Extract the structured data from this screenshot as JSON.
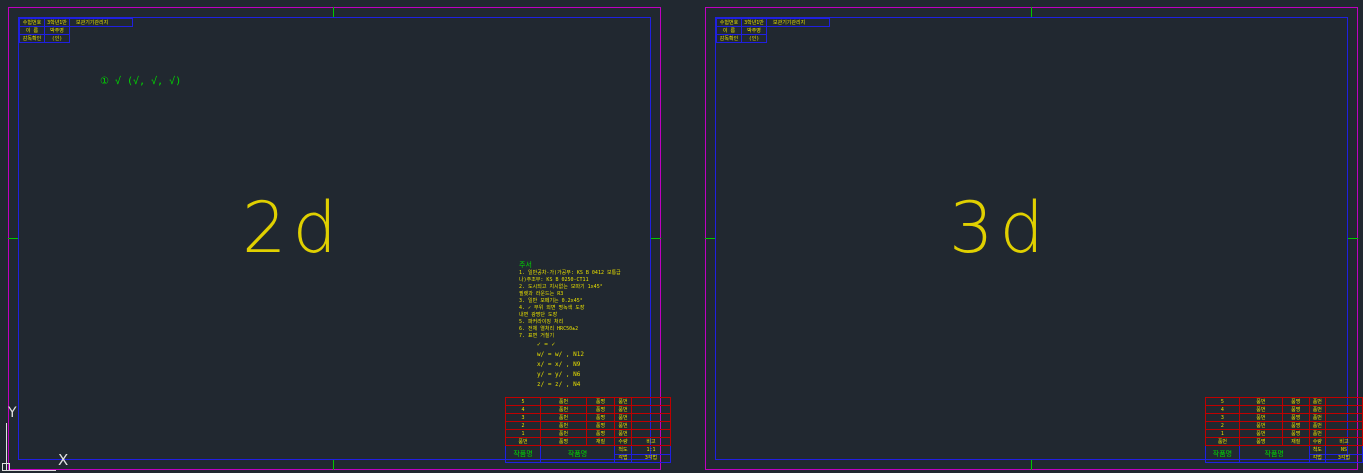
{
  "sheets": [
    {
      "label": "2d",
      "header": {
        "rows": [
          [
            "수험번호",
            "3학년1반"
          ],
          [
            "이 름",
            "박주영"
          ],
          [
            "감독확인",
            "(인)"
          ]
        ],
        "title": "보관기기관리지"
      },
      "symbol_note": "① √ (√, √, √)",
      "notes": {
        "heading": "주서",
        "lines": [
          "1. 일반공차-가)가공부: KS B 0412 보통급",
          "     나)주조부: KS B 0250-CT11",
          "2. 도시되고 지시없는 모따기 1x45°",
          "     필렛과 라운드는 R3",
          "3. 일반 모떼기는 0.2x45°",
          "4. ✓ 부위 외면 명녹색 도장",
          "     내면 광명단 도장",
          "5. 파커라이징 처리",
          "6. 전체 열처리 HRC50±2",
          "7. 표면 거칠기"
        ],
        "roughness": [
          "✓ = ✓",
          "w/ = w/ , N12",
          "x/ = x/ , N9",
          "y/ = y/ , N6",
          "z/ = z/ , N4"
        ]
      },
      "parts_table": {
        "rows": [
          [
            "5",
            "품번",
            "품명",
            "품번",
            ""
          ],
          [
            "4",
            "품번",
            "품명",
            "품번",
            ""
          ],
          [
            "3",
            "품번",
            "품명",
            "품번",
            ""
          ],
          [
            "2",
            "품번",
            "품명",
            "품번",
            ""
          ],
          [
            "1",
            "품번",
            "품명",
            "품번",
            ""
          ]
        ],
        "header": [
          "품번",
          "품명",
          "재질",
          "수량",
          "비고"
        ],
        "footer": {
          "left": "작품명",
          "mid": "작품명",
          "scale_label": "척도",
          "scale_value": "1:1",
          "proj_label": "각법",
          "proj_value": "3각법"
        }
      },
      "show_notes": true
    },
    {
      "label": "3d",
      "header": {
        "rows": [
          [
            "수험번호",
            "3학년1반"
          ],
          [
            "이 름",
            "박주영"
          ],
          [
            "감독확인",
            "(인)"
          ]
        ],
        "title": "보관기기관리지"
      },
      "parts_table": {
        "rows": [
          [
            "5",
            "품번",
            "품명",
            "품번",
            ""
          ],
          [
            "4",
            "품번",
            "품명",
            "품번",
            ""
          ],
          [
            "3",
            "품번",
            "품명",
            "품번",
            ""
          ],
          [
            "2",
            "품번",
            "품명",
            "품번",
            ""
          ],
          [
            "1",
            "품번",
            "품명",
            "품번",
            ""
          ]
        ],
        "header": [
          "품번",
          "품명",
          "재질",
          "수량",
          "비고"
        ],
        "footer": {
          "left": "작품명",
          "mid": "작품명",
          "scale_label": "척도",
          "scale_value": "NS",
          "proj_label": "각법",
          "proj_value": "3각법"
        }
      },
      "show_notes": false
    }
  ],
  "ucs": {
    "y_label": "Y",
    "x_label": "X"
  }
}
